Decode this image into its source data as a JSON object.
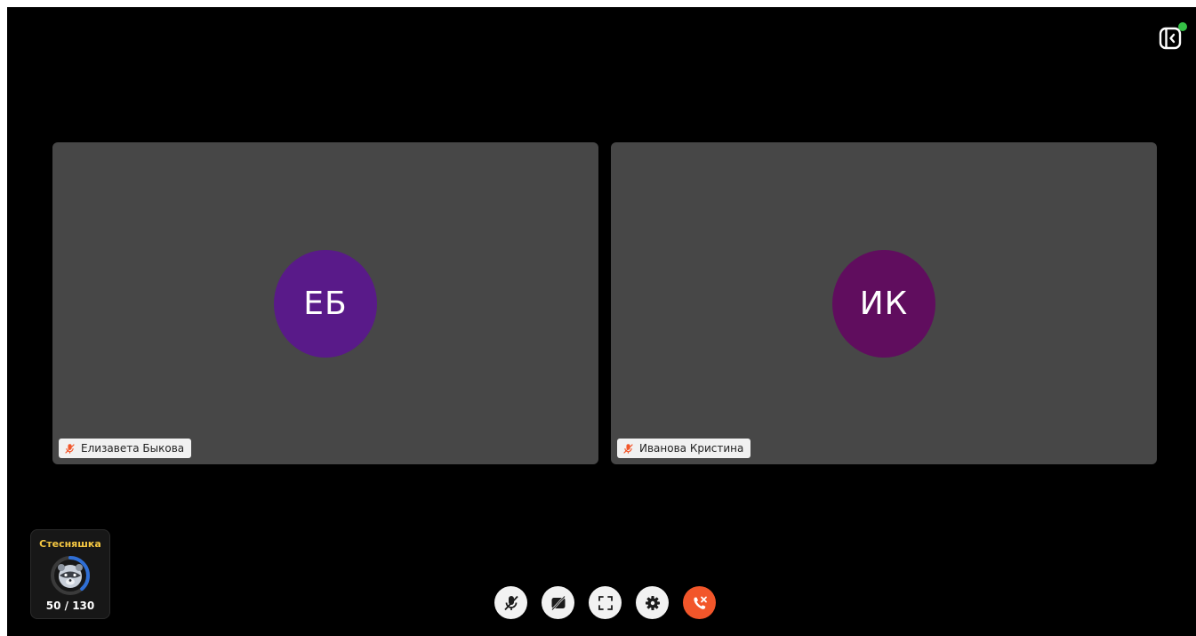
{
  "participants": [
    {
      "initials": "ЕБ",
      "name": "Елизавета Быкова",
      "avatar_color": "#591a89",
      "mic_icon": "mic-off-icon"
    },
    {
      "initials": "ИК",
      "name": "Иванова Кристина",
      "avatar_color": "#600d5e",
      "mic_icon": "mic-off-icon"
    }
  ],
  "badge": {
    "title": "Стесняшка",
    "title_color": "#f5c842",
    "count": "50 / 130",
    "progress": 0.385,
    "ring_color": "#2f6fd6",
    "icon": "raccoon-icon"
  },
  "header": {
    "panel_toggle_icon": "panel-collapse-icon",
    "status_color": "#35c046"
  },
  "controls": [
    {
      "icon": "mic-off-icon",
      "name": "mute-toggle-button"
    },
    {
      "icon": "camera-off-icon",
      "name": "camera-toggle-button"
    },
    {
      "icon": "fullscreen-icon",
      "name": "fullscreen-button"
    },
    {
      "icon": "gear-icon",
      "name": "settings-button"
    },
    {
      "icon": "end-call-icon",
      "name": "end-call-button",
      "color": "#f2562a"
    }
  ],
  "colors": {
    "background": "#000000",
    "tile": "#474747",
    "accent_red": "#f2562a"
  }
}
